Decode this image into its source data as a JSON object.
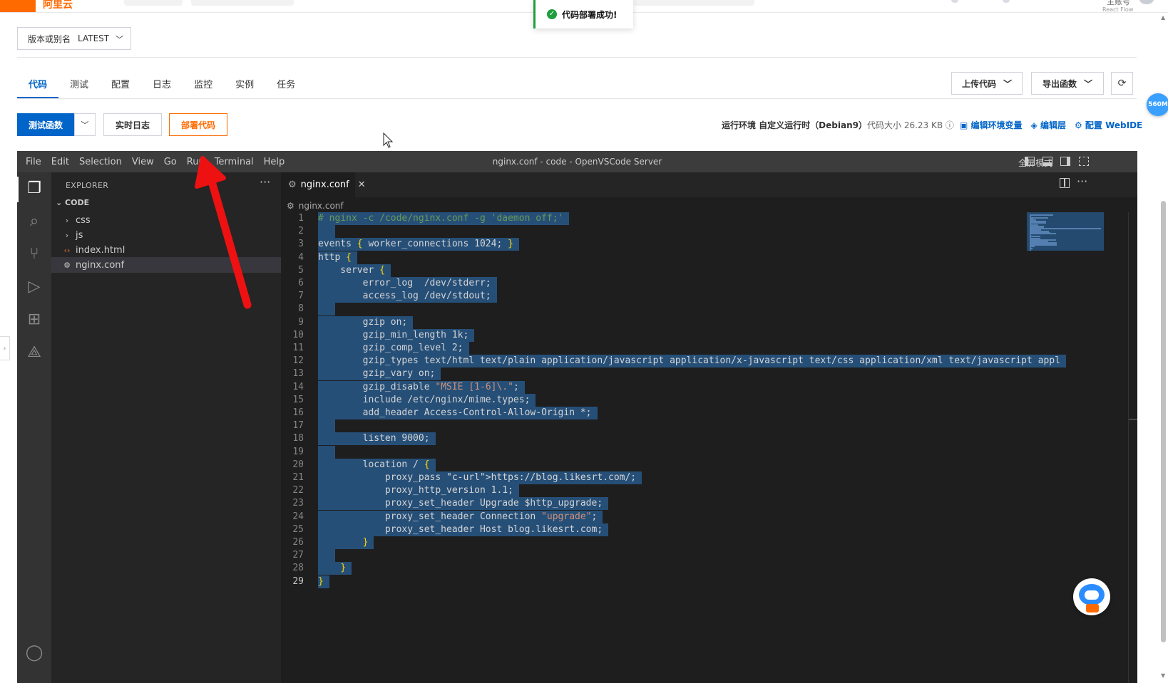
{
  "toast": {
    "message": "代码部署成功!"
  },
  "topbar": {
    "account": "主账号",
    "subtitle": "React Flow",
    "logo": "阿里云"
  },
  "version": {
    "label": "版本或别名",
    "value": "LATEST"
  },
  "tabs": [
    {
      "label": "代码",
      "active": true
    },
    {
      "label": "测试"
    },
    {
      "label": "配置"
    },
    {
      "label": "日志"
    },
    {
      "label": "监控"
    },
    {
      "label": "实例"
    },
    {
      "label": "任务"
    }
  ],
  "toolbar": {
    "upload_label": "上传代码",
    "export_label": "导出函数",
    "test_label": "测试函数",
    "log_label": "实时日志",
    "deploy_label": "部署代码",
    "runtime_label": "运行环境 自定义运行时（Debian9）",
    "code_size_label": "代码大小 26.23 KB",
    "link_env": "编辑环境变量",
    "link_layer": "编辑层",
    "link_webide": "配置 WebIDE"
  },
  "memory_badge": "560M",
  "vscode": {
    "menu": [
      "File",
      "Edit",
      "Selection",
      "View",
      "Go",
      "Run",
      "Terminal",
      "Help"
    ],
    "window_title": "nginx.conf - code - OpenVSCode Server",
    "fullscreen_label": "全屏模式",
    "explorer_title": "EXPLORER",
    "section": "CODE",
    "tree": [
      {
        "label": "css",
        "type": "folder"
      },
      {
        "label": "js",
        "type": "folder"
      },
      {
        "label": "index.html",
        "type": "html"
      },
      {
        "label": "nginx.conf",
        "type": "gear",
        "selected": true
      }
    ],
    "tab_label": "nginx.conf",
    "breadcrumb": "nginx.conf",
    "current_line": 29,
    "code_lines": [
      "# nginx -c /code/nginx.conf -g 'daemon off;'",
      "",
      "events { worker_connections 1024; }",
      "http {",
      "    server {",
      "        error_log  /dev/stderr;",
      "        access_log /dev/stdout;",
      "",
      "        gzip on;",
      "        gzip_min_length 1k;",
      "        gzip_comp_level 2;",
      "        gzip_types text/html text/plain application/javascript application/x-javascript text/css application/xml text/javascript appl",
      "        gzip_vary on;",
      "        gzip_disable \"MSIE [1-6]\\.\";",
      "        include /etc/nginx/mime.types;",
      "        add_header Access-Control-Allow-Origin *;",
      "",
      "        listen 9000;",
      "",
      "        location / {",
      "            proxy_pass https://blog.likesrt.com/;",
      "            proxy_http_version 1.1;",
      "            proxy_set_header Upgrade $http_upgrade;",
      "            proxy_set_header Connection \"upgrade\";",
      "            proxy_set_header Host blog.likesrt.com;",
      "        }",
      "",
      "    }",
      "}"
    ]
  },
  "colors": {
    "accent": "#0064c8",
    "deploy": "#ff6a00",
    "success": "#1e9e3e",
    "annotation_arrow": "#ee1111"
  }
}
